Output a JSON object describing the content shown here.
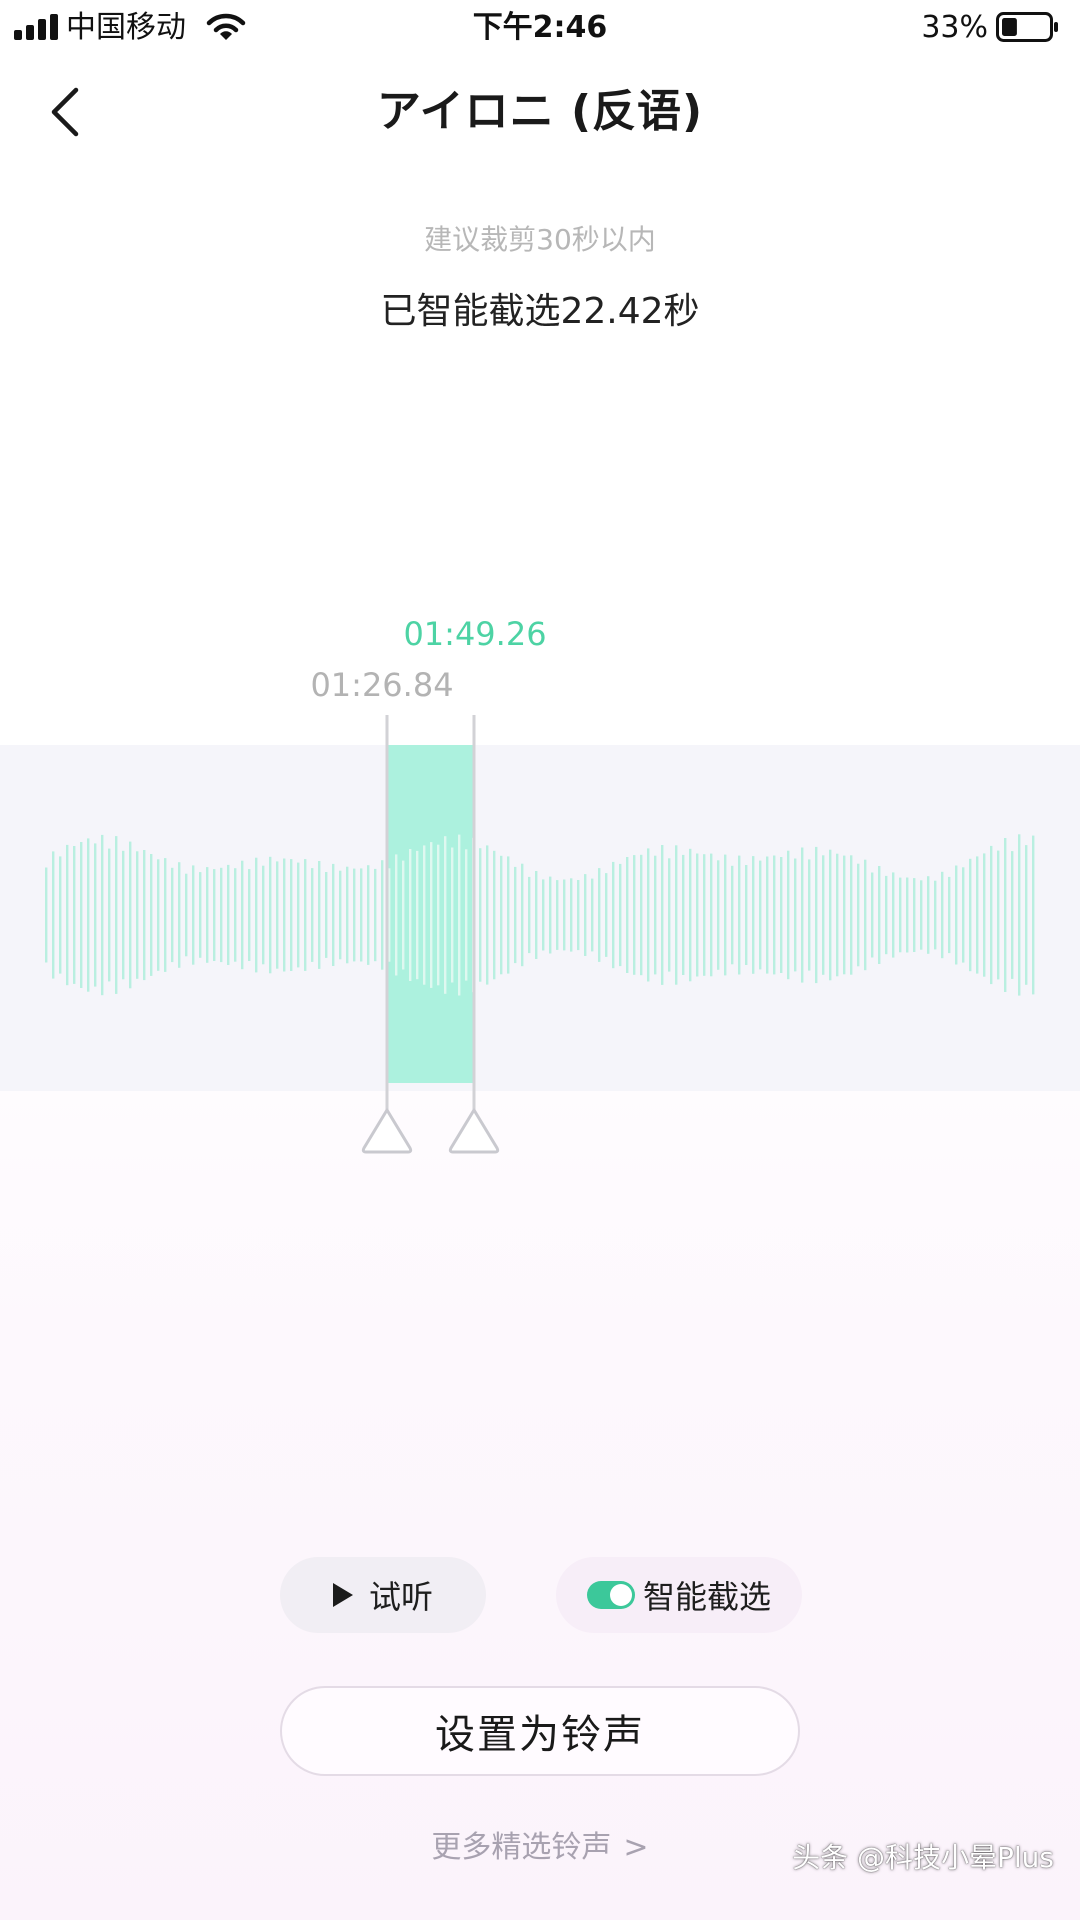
{
  "status_bar": {
    "carrier": "中国移动",
    "time": "下午2:46",
    "battery_percent": "33%",
    "battery_level": 0.33
  },
  "header": {
    "title": "アイロニ (反语)"
  },
  "hint": "建议裁剪30秒以内",
  "selection": {
    "summary": "已智能截选22.42秒",
    "start_time": "01:26.84",
    "end_time": "01:49.26"
  },
  "colors": {
    "accent": "#4dd3a4",
    "wave": "#b9efe0",
    "selection_fill": "#9ff0d8"
  },
  "controls": {
    "preview_label": "试听",
    "smart_select_label": "智能截选",
    "smart_select_on": true,
    "set_ringtone_label": "设置为铃声",
    "more_label": "更多精选铃声",
    "more_chevron": ">"
  },
  "watermark": "头条 @科技小晕Plus"
}
